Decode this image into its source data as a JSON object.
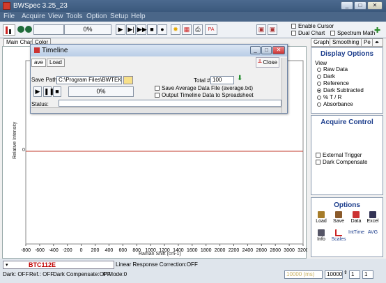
{
  "window": {
    "title": "BWSpec 3.25_23"
  },
  "menu": [
    "File",
    "Acquire",
    "View",
    "Tools",
    "Option",
    "Setup",
    "Help"
  ],
  "toolbar": {
    "progress": "0%",
    "enable_cursor": "Enable Cursor",
    "dual_chart": "Dual Chart",
    "spectrum_math": "Spectrum Math"
  },
  "tabs": {
    "main_chart": "Main Chart",
    "color": "Color"
  },
  "right_tabs": [
    "Graph",
    "Smoothing",
    "Pe"
  ],
  "display_options": {
    "title": "Display Options",
    "group": "View",
    "options": [
      "Raw Data",
      "Dark",
      "Reference",
      "Dark Subtracted",
      "% T / R",
      "Absorbance"
    ],
    "selected": "Dark Subtracted"
  },
  "acquire_control": {
    "title": "Acquire Control",
    "external_trigger": "External Trigger",
    "dark_compensate": "Dark Compensate"
  },
  "options": {
    "title": "Options",
    "buttons": [
      "Load",
      "Save",
      "Data",
      "Excel",
      "Info",
      "Scales",
      "IntTime",
      "AVG"
    ]
  },
  "chart": {
    "ylabel": "Relative Intensity",
    "xlabel": "Raman Shift (cm-1)",
    "y_tick": "0",
    "x_ticks": [
      "-800",
      "-600",
      "-400",
      "-200",
      "0",
      "200",
      "400",
      "600",
      "800",
      "1000",
      "1200",
      "1400",
      "1600",
      "1800",
      "2000",
      "2200",
      "2400",
      "2600",
      "2800",
      "3000",
      "3200"
    ]
  },
  "timeline": {
    "title": "Timeline",
    "tab_save": "ave",
    "tab_load": "Load",
    "close": "Close",
    "save_path_label": "Save Path",
    "save_path": "C:\\Program Files\\BWTEK\\BWSpec",
    "total_label": "Total #",
    "total": "100",
    "progress": "0%",
    "save_avg": "Save Average Data File (average.txt)",
    "output_timeline": "Output Timeline Data to Spreadsheet",
    "status_label": "Status:"
  },
  "statusbar": {
    "device": "BTC112E",
    "linear": "Linear Response Correction:OFF",
    "dark": "Dark: OFF",
    "ref": "Ref.: OFF",
    "dark_comp": "Dark Compensate:OFF",
    "pmode": "P Mode:0",
    "inttime_display": "10000 (ms)",
    "inttime": "10000",
    "avg": "1",
    "extra": "1"
  },
  "colors": {
    "zero_line": "#c0392b",
    "title_blue": "#1c3d8c",
    "device_red": "#c00000"
  }
}
